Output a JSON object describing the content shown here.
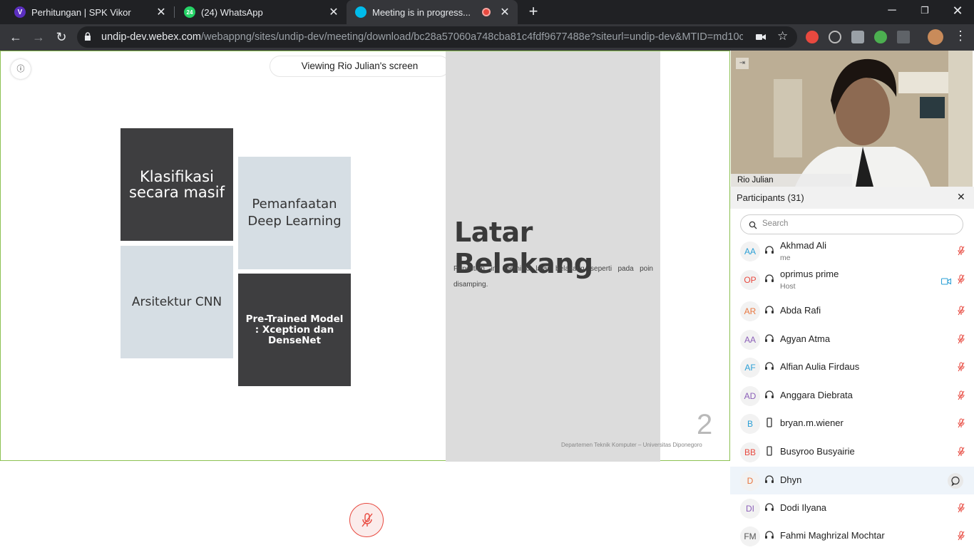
{
  "browser": {
    "tabs": [
      {
        "label": "Perhitungan | SPK Vikor",
        "favicon": "V"
      },
      {
        "label": "(24) WhatsApp",
        "favicon": "24"
      },
      {
        "label": "Meeting is in progress...",
        "favicon": ""
      }
    ],
    "url_host": "undip-dev.webex.com",
    "url_path": "/webappng/sites/undip-dev/meeting/download/bc28a57060a748cba81c4fdf9677488e?siteurl=undip-dev&MTID=md10cc..."
  },
  "meeting": {
    "viewing_label": "Viewing Rio Julian's screen",
    "video_name": "Rio Julian"
  },
  "slide": {
    "tiles": [
      "Klasifikasi secara masif",
      "Pemanfaatan Deep Learning",
      "Arsitektur CNN",
      "Pre-Trained Model : Xception dan DenseNet"
    ],
    "title": "Latar Belakang",
    "body": "Penelitian ini memiliki latar belakang seperti pada poin disamping.",
    "page_number": "2",
    "footer": "Departemen Teknik Komputer – Universitas Diponegoro"
  },
  "participants": {
    "title": "Participants (31)",
    "search_placeholder": "Search",
    "list": [
      {
        "initials": "AA",
        "name": "Akhmad Ali",
        "role": "me",
        "color": "#2a9fd6"
      },
      {
        "initials": "OP",
        "name": "oprimus prime",
        "role": "Host",
        "color": "#e8493f"
      },
      {
        "initials": "AR",
        "name": "Abda Rafi",
        "role": "",
        "color": "#e8763f"
      },
      {
        "initials": "AA",
        "name": "Agyan Atma",
        "role": "",
        "color": "#8b5fb8"
      },
      {
        "initials": "AF",
        "name": "Alfian Aulia Firdaus",
        "role": "",
        "color": "#2a9fd6"
      },
      {
        "initials": "AD",
        "name": "Anggara Diebrata",
        "role": "",
        "color": "#8b5fb8"
      },
      {
        "initials": "B",
        "name": "bryan.m.wiener",
        "role": "",
        "color": "#2a9fd6"
      },
      {
        "initials": "BB",
        "name": "Busyroo Busyairie",
        "role": "",
        "color": "#e8493f"
      },
      {
        "initials": "D",
        "name": "Dhyn",
        "role": "",
        "color": "#e8763f"
      },
      {
        "initials": "DI",
        "name": "Dodi Ilyana",
        "role": "",
        "color": "#8b5fb8"
      },
      {
        "initials": "FM",
        "name": "Fahmi Maghrizal Mochtar",
        "role": "",
        "color": "#555555"
      }
    ]
  }
}
